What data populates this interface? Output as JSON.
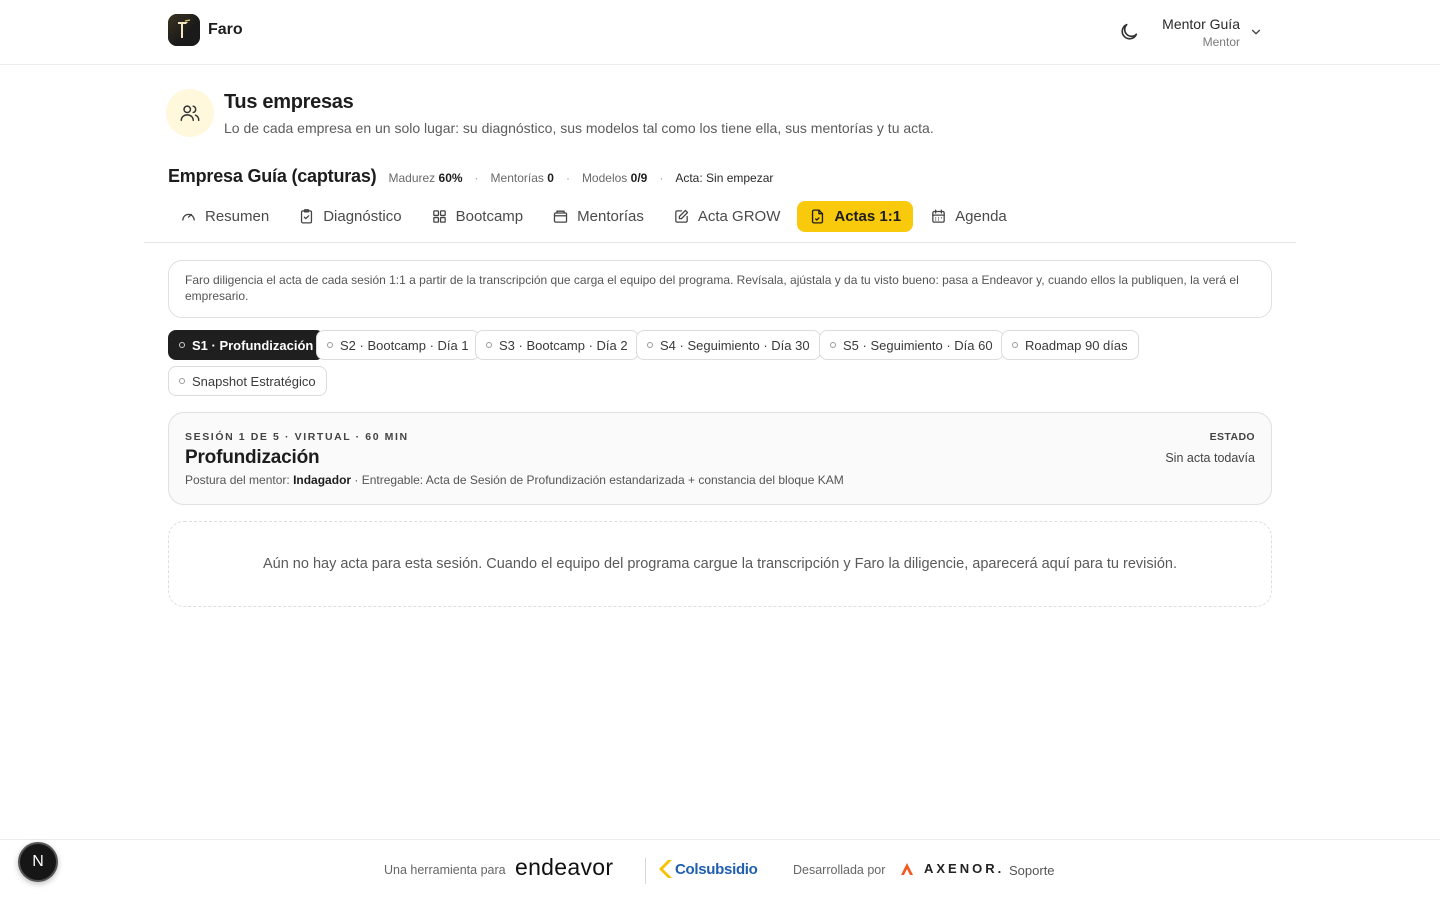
{
  "header": {
    "app_name": "Faro",
    "user": {
      "name": "Mentor Guía",
      "role": "Mentor"
    }
  },
  "page": {
    "title": "Tus empresas",
    "subtitle": "Lo de cada empresa en un solo lugar: su diagnóstico, sus modelos tal como los tiene ella, sus mentorías y tu acta."
  },
  "company": {
    "name": "Empresa Guía (capturas)",
    "madurez_label": "Madurez",
    "madurez_value": "60%",
    "mentorias_label": "Mentorías",
    "mentorias_value": "0",
    "modelos_label": "Modelos",
    "modelos_value": "0/9",
    "acta_label": "Acta:",
    "acta_value": "Sin empezar",
    "separator": "·"
  },
  "tabs": [
    {
      "label": "Resumen",
      "icon": "gauge-icon"
    },
    {
      "label": "Diagnóstico",
      "icon": "clipboard-check-icon"
    },
    {
      "label": "Bootcamp",
      "icon": "grid-icon"
    },
    {
      "label": "Mentorías",
      "icon": "folder-icon"
    },
    {
      "label": "Acta GROW",
      "icon": "edit-note-icon"
    },
    {
      "label": "Actas 1:1",
      "icon": "document-icon",
      "active": true
    },
    {
      "label": "Agenda",
      "icon": "calendar-icon"
    }
  ],
  "info_text": "Faro diligencia el acta de cada sesión 1:1 a partir de la transcripción que carga el equipo del programa. Revísala, ajústala y da tu visto bueno: pasa a Endeavor y, cuando ellos la publiquen, la verá el empresario.",
  "sessions": [
    {
      "label": "S1 · Profundización",
      "active": true
    },
    {
      "label": "S2 · Bootcamp · Día 1"
    },
    {
      "label": "S3 · Bootcamp · Día 2"
    },
    {
      "label": "S4 · Seguimiento · Día 30"
    },
    {
      "label": "S5 · Seguimiento · Día 60"
    },
    {
      "label": "Roadmap 90 días"
    },
    {
      "label": "Snapshot Estratégico"
    }
  ],
  "session_detail": {
    "meta": "SESIÓN 1 DE 5 · VIRTUAL · 60 MIN",
    "title": "Profundización",
    "posture_label": "Postura del mentor:",
    "posture_value": "Indagador",
    "deliverable": "· Entregable: Acta de Sesión de Profundización estandarizada + constancia del bloque KAM",
    "estado_label": "ESTADO",
    "estado_value": "Sin acta todavía"
  },
  "empty_state": "Aún no hay acta para esta sesión. Cuando el equipo del programa cargue la transcripción y Faro la diligencie, aparecerá aquí para tu revisión.",
  "footer": {
    "tool_for": "Una herramienta para",
    "endeavor": "endeavor",
    "colsubsidio": "Colsubsidio",
    "developed_by": "Desarrollada por",
    "axenor": "AXENOR.",
    "support": "Soporte"
  },
  "dev_badge": "N",
  "colors": {
    "accent": "#f9c90c",
    "active_pill": "#1f1f1f",
    "colsubsidio_blue": "#1f5fae",
    "colsubsidio_yellow": "#f7c300",
    "axenor_orange": "#f05a22"
  }
}
